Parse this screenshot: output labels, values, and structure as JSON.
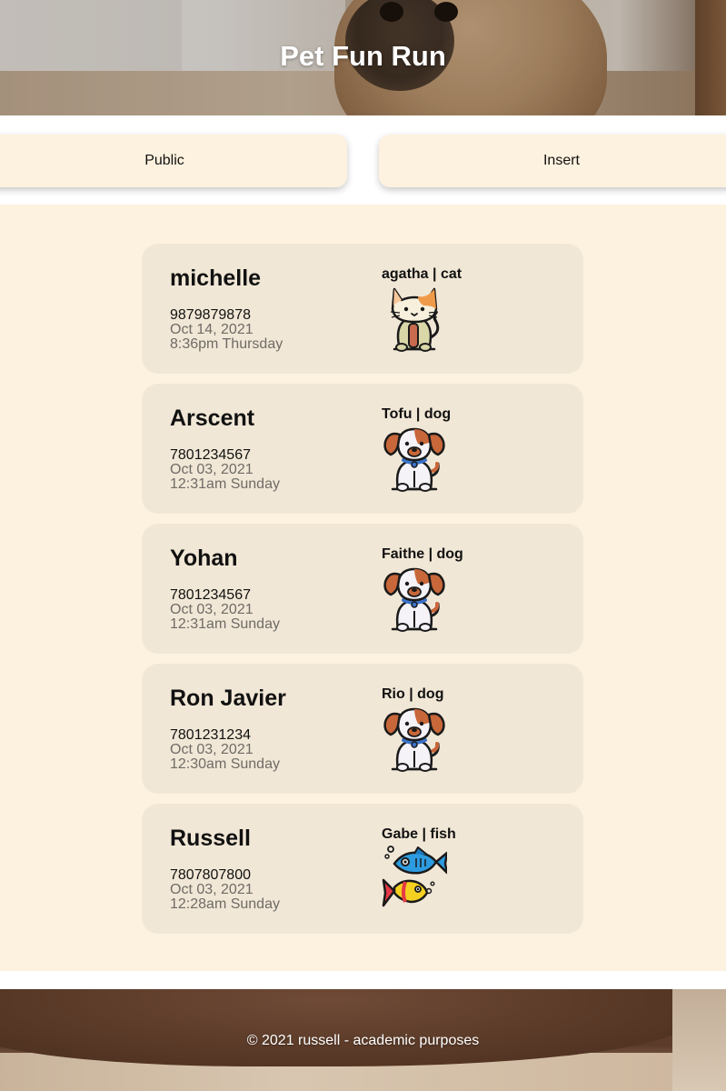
{
  "header": {
    "title": "Pet Fun Run"
  },
  "nav": {
    "public_label": "Public",
    "insert_label": "Insert"
  },
  "entries": [
    {
      "owner": "michelle",
      "phone": "9879879878",
      "date": "Oct 14, 2021",
      "time": "8:36pm Thursday",
      "pet": "agatha | cat",
      "pet_icon": "cat-icon"
    },
    {
      "owner": "Arscent",
      "phone": "7801234567",
      "date": "Oct 03, 2021",
      "time": "12:31am Sunday",
      "pet": "Tofu | dog",
      "pet_icon": "dog-icon"
    },
    {
      "owner": "Yohan",
      "phone": "7801234567",
      "date": "Oct 03, 2021",
      "time": "12:31am Sunday",
      "pet": "Faithe | dog",
      "pet_icon": "dog-icon"
    },
    {
      "owner": "Ron Javier",
      "phone": "7801231234",
      "date": "Oct 03, 2021",
      "time": "12:30am Sunday",
      "pet": "Rio | dog",
      "pet_icon": "dog-icon"
    },
    {
      "owner": "Russell",
      "phone": "7807807800",
      "date": "Oct 03, 2021",
      "time": "12:28am Sunday",
      "pet": "Gabe | fish",
      "pet_icon": "fish-icon"
    }
  ],
  "footer": {
    "text": "© 2021 russell - academic purposes"
  },
  "colors": {
    "page_background": "#fdf2df",
    "card_background": "#f1e7d6",
    "nav_button_background": "#fdf2df",
    "muted_text": "#6f6b66"
  }
}
